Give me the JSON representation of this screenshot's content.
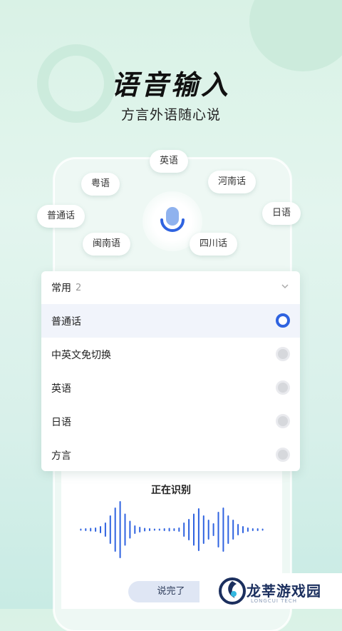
{
  "header": {
    "title": "语音输入",
    "subtitle": "方言外语随心说"
  },
  "bubbles": [
    {
      "label": "英语"
    },
    {
      "label": "粤语"
    },
    {
      "label": "河南话"
    },
    {
      "label": "普通话"
    },
    {
      "label": "日语"
    },
    {
      "label": "闽南语"
    },
    {
      "label": "四川话"
    }
  ],
  "panel": {
    "header_label": "常用",
    "header_count": "2",
    "options": [
      {
        "label": "普通话",
        "selected": true
      },
      {
        "label": "中英文免切换",
        "selected": false
      },
      {
        "label": "英语",
        "selected": false
      },
      {
        "label": "日语",
        "selected": false
      },
      {
        "label": "方言",
        "selected": false
      }
    ]
  },
  "recognition": {
    "status": "正在识别",
    "done_button": "说完了"
  },
  "watermark": {
    "name": "龙莘游戏园",
    "sub": "LONGCUI TECH"
  },
  "colors": {
    "accent": "#2f63e0",
    "wave": "#2f63e0",
    "brand": "#1b2f5e"
  },
  "icons": [
    "mic-icon",
    "chevron-down-icon",
    "brand-logo-icon"
  ]
}
